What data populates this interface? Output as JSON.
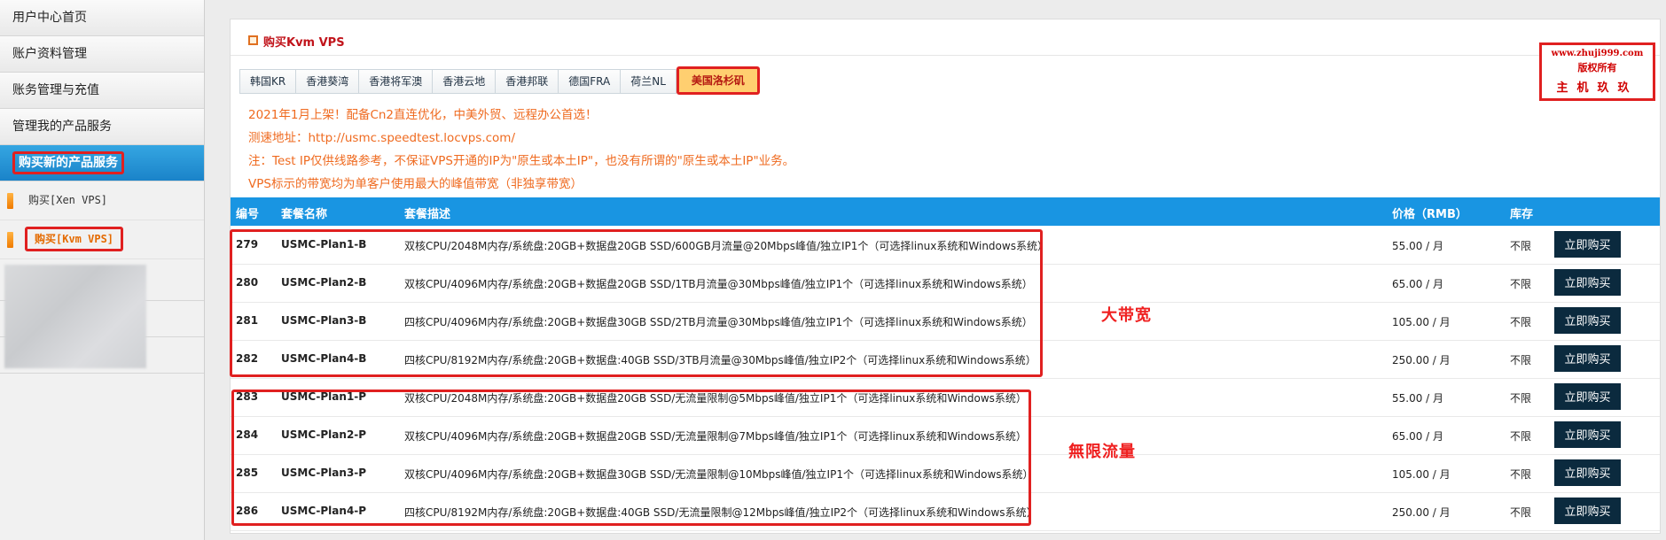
{
  "sidebar": {
    "items": [
      {
        "label": "用户中心首页"
      },
      {
        "label": "账户资料管理"
      },
      {
        "label": "账务管理与充值"
      },
      {
        "label": "管理我的产品服务"
      },
      {
        "label": "购买新的产品服务"
      }
    ],
    "sub_items": [
      {
        "label": "购买[Xen VPS]"
      },
      {
        "label": "购买[Kvm VPS]"
      }
    ]
  },
  "panel": {
    "title": "购买Kvm VPS"
  },
  "tabs": [
    {
      "label": "韩国KR"
    },
    {
      "label": "香港葵湾"
    },
    {
      "label": "香港将军澳"
    },
    {
      "label": "香港云地"
    },
    {
      "label": "香港邦联"
    },
    {
      "label": "德国FRA"
    },
    {
      "label": "荷兰NL"
    },
    {
      "label": "美国洛杉矶"
    }
  ],
  "watermark": {
    "line1": "www.zhuji999.com",
    "line2": "版权所有",
    "line3": "主机玖玖"
  },
  "notes": [
    "2021年1月上架！配备Cn2直连优化，中美外贸、远程办公首选！",
    "测速地址：http://usmc.speedtest.locvps.com/",
    "注：Test IP仅供线路参考，不保证VPS开通的IP为\"原生或本土IP\"，也没有所谓的\"原生或本土IP\"业务。",
    "VPS标示的带宽均为单客户使用最大的峰值带宽（非独享带宽）"
  ],
  "table": {
    "headers": {
      "id": "编号",
      "name": "套餐名称",
      "desc": "套餐描述",
      "price": "价格（RMB）",
      "stock": "库存"
    },
    "buy_label": "立即购买",
    "rows": [
      {
        "id": "279",
        "name": "USMC-Plan1-B",
        "desc": "双核CPU/2048M内存/系统盘:20GB+数据盘20GB SSD/600GB月流量@20Mbps峰值/独立IP1个（可选择linux系统和Windows系统）",
        "price": "55.00 / 月",
        "stock": "不限"
      },
      {
        "id": "280",
        "name": "USMC-Plan2-B",
        "desc": "双核CPU/4096M内存/系统盘:20GB+数据盘20GB SSD/1TB月流量@30Mbps峰值/独立IP1个（可选择linux系统和Windows系统）",
        "price": "65.00 / 月",
        "stock": "不限"
      },
      {
        "id": "281",
        "name": "USMC-Plan3-B",
        "desc": "四核CPU/4096M内存/系统盘:20GB+数据盘30GB SSD/2TB月流量@30Mbps峰值/独立IP1个（可选择linux系统和Windows系统）",
        "price": "105.00 / 月",
        "stock": "不限"
      },
      {
        "id": "282",
        "name": "USMC-Plan4-B",
        "desc": "四核CPU/8192M内存/系统盘:20GB+数据盘:40GB SSD/3TB月流量@30Mbps峰值/独立IP2个（可选择linux系统和Windows系统）",
        "price": "250.00 / 月",
        "stock": "不限"
      },
      {
        "id": "283",
        "name": "USMC-Plan1-P",
        "desc": "双核CPU/2048M内存/系统盘:20GB+数据盘20GB SSD/无流量限制@5Mbps峰值/独立IP1个（可选择linux系统和Windows系统）",
        "price": "55.00 / 月",
        "stock": "不限"
      },
      {
        "id": "284",
        "name": "USMC-Plan2-P",
        "desc": "双核CPU/4096M内存/系统盘:20GB+数据盘20GB SSD/无流量限制@7Mbps峰值/独立IP1个（可选择linux系统和Windows系统）",
        "price": "65.00 / 月",
        "stock": "不限"
      },
      {
        "id": "285",
        "name": "USMC-Plan3-P",
        "desc": "双核CPU/4096M内存/系统盘:20GB+数据盘30GB SSD/无流量限制@10Mbps峰值/独立IP1个（可选择linux系统和Windows系统）",
        "price": "105.00 / 月",
        "stock": "不限"
      },
      {
        "id": "286",
        "name": "USMC-Plan4-P",
        "desc": "四核CPU/8192M内存/系统盘:20GB+数据盘:40GB SSD/无流量限制@12Mbps峰值/独立IP2个（可选择linux系统和Windows系统）",
        "price": "250.00 / 月",
        "stock": "不限"
      }
    ]
  },
  "annotations": {
    "group1": "大带宽",
    "group2": "無限流量"
  },
  "colors": {
    "accent": "#1995e2",
    "highlight": "#e02020",
    "note": "#ef6a1f",
    "buy_button": "#0b2a3e"
  }
}
